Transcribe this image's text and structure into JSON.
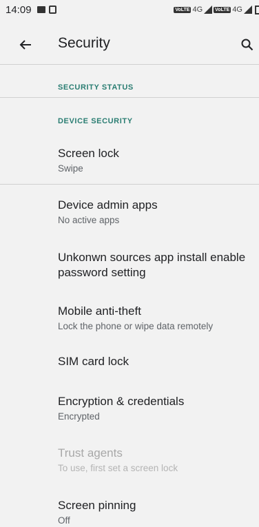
{
  "status_bar": {
    "time": "14:09",
    "net1": "4G",
    "net2": "4G",
    "volte": "VoLTE"
  },
  "app_bar": {
    "title": "Security"
  },
  "sections": {
    "security_status": "SECURITY STATUS",
    "device_security": "DEVICE SECURITY"
  },
  "settings": [
    {
      "title": "Screen lock",
      "summary": "Swipe"
    },
    {
      "title": "Device admin apps",
      "summary": "No active apps"
    },
    {
      "title": "Unkonwn sources app install enable password setting",
      "summary": ""
    },
    {
      "title": "Mobile anti-theft",
      "summary": "Lock the phone or wipe data remotely"
    },
    {
      "title": "SIM card lock",
      "summary": ""
    },
    {
      "title": "Encryption & credentials",
      "summary": "Encrypted"
    },
    {
      "title": "Trust agents",
      "summary": "To use, first set a screen lock"
    },
    {
      "title": "Screen pinning",
      "summary": "Off"
    }
  ],
  "colors": {
    "background": "#f2f2f2",
    "section_header": "#2a7d72",
    "disabled_text": "#a8a8a8"
  },
  "icons": {
    "back": "arrow-back-icon",
    "search": "search-icon"
  }
}
